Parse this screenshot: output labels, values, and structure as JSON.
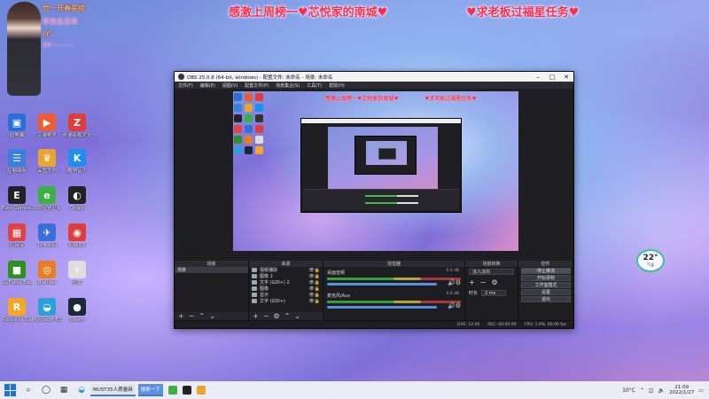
{
  "overlay": {
    "left": "感激上周榜一♥芯悦家的南城♥",
    "right": "♥求老板过福星任务♥"
  },
  "streamer_lines": [
    "世一开春誓綾",
    "年来永乐年",
    "(Y)",
    "YY··········"
  ],
  "desktop_icons": [
    {
      "label": "此电脑",
      "color": "#2a6fd6",
      "glyph": "▣"
    },
    {
      "label": "豆游电竞",
      "color": "#f05b34",
      "glyph": "▶"
    },
    {
      "label": "奇德影视大全",
      "color": "#e03c3c",
      "glyph": "Z"
    },
    {
      "label": "控制面板",
      "color": "#3a7fd9",
      "glyph": "☰"
    },
    {
      "label": "高管大师",
      "color": "#e8a530",
      "glyph": "♛"
    },
    {
      "label": "酷狗音乐",
      "color": "#1f8ef1",
      "glyph": "K"
    },
    {
      "label": "Epic Games Launcher",
      "color": "#222",
      "glyph": "E"
    },
    {
      "label": "360安全卫士",
      "color": "#3cb043",
      "glyph": "e"
    },
    {
      "label": "Origin",
      "color": "#222",
      "glyph": "◐"
    },
    {
      "label": "应用宝",
      "color": "#e04343",
      "glyph": "▦"
    },
    {
      "label": "科学上网",
      "color": "#3a6fd9",
      "glyph": "✈"
    },
    {
      "label": "网易UU",
      "color": "#e03c3c",
      "glyph": "◉"
    },
    {
      "label": "GeForce Experience",
      "color": "#2f8f1f",
      "glyph": "■"
    },
    {
      "label": "Blender",
      "color": "#e67e22",
      "glyph": "◎"
    },
    {
      "label": "迅雷",
      "color": "#ddd",
      "glyph": "✧"
    },
    {
      "label": "Rockstar Games Launcher",
      "color": "#f5a623",
      "glyph": "R"
    },
    {
      "label": "Microsoft Edge",
      "color": "#2ba0d9",
      "glyph": "◒"
    },
    {
      "label": "Steam",
      "color": "#1b2838",
      "glyph": "●"
    }
  ],
  "weather_widget": {
    "temp": "22°",
    "sub": "气温"
  },
  "obs": {
    "title": "OBS 25.0.8 (64-bit, windows) - 配置文件: 未命名 - 场景: 未命名",
    "menu": [
      "文件(F)",
      "编辑(E)",
      "视图(V)",
      "配置文件(P)",
      "场景集合(S)",
      "工具(T)",
      "帮助(H)"
    ],
    "docks": {
      "scenes": "场景",
      "sources": "来源",
      "mixer": "混音器",
      "transitions": "场景转换",
      "controls": "控件"
    },
    "scenes": [
      "场景"
    ],
    "sources": [
      {
        "name": "视频捕获"
      },
      {
        "name": "图像 2"
      },
      {
        "name": "文字 (GDI+) 2"
      },
      {
        "name": "图像"
      },
      {
        "name": "显示"
      },
      {
        "name": "文字 (GDI+)"
      }
    ],
    "mixer": [
      {
        "name": "桌面音频",
        "db": "0.0 dB"
      },
      {
        "name": "麦克风/Aux",
        "db": "0.0 dB"
      }
    ],
    "transition": {
      "type": "淡入淡出",
      "duration_label": "时长",
      "duration": "2 ms"
    },
    "controls": [
      "停止推流",
      "开始录制",
      "工作室模式",
      "设置",
      "退出"
    ],
    "status": [
      "LIVE: 12:00",
      "REC: 00:00:00",
      "CPU: 1.9%, 60.00 fps"
    ]
  },
  "taskbar": {
    "apps": [
      "MUST35人质量麻",
      "搜索一下"
    ],
    "weather": "10°C",
    "time": "21:09",
    "date": "2022/1/27"
  }
}
